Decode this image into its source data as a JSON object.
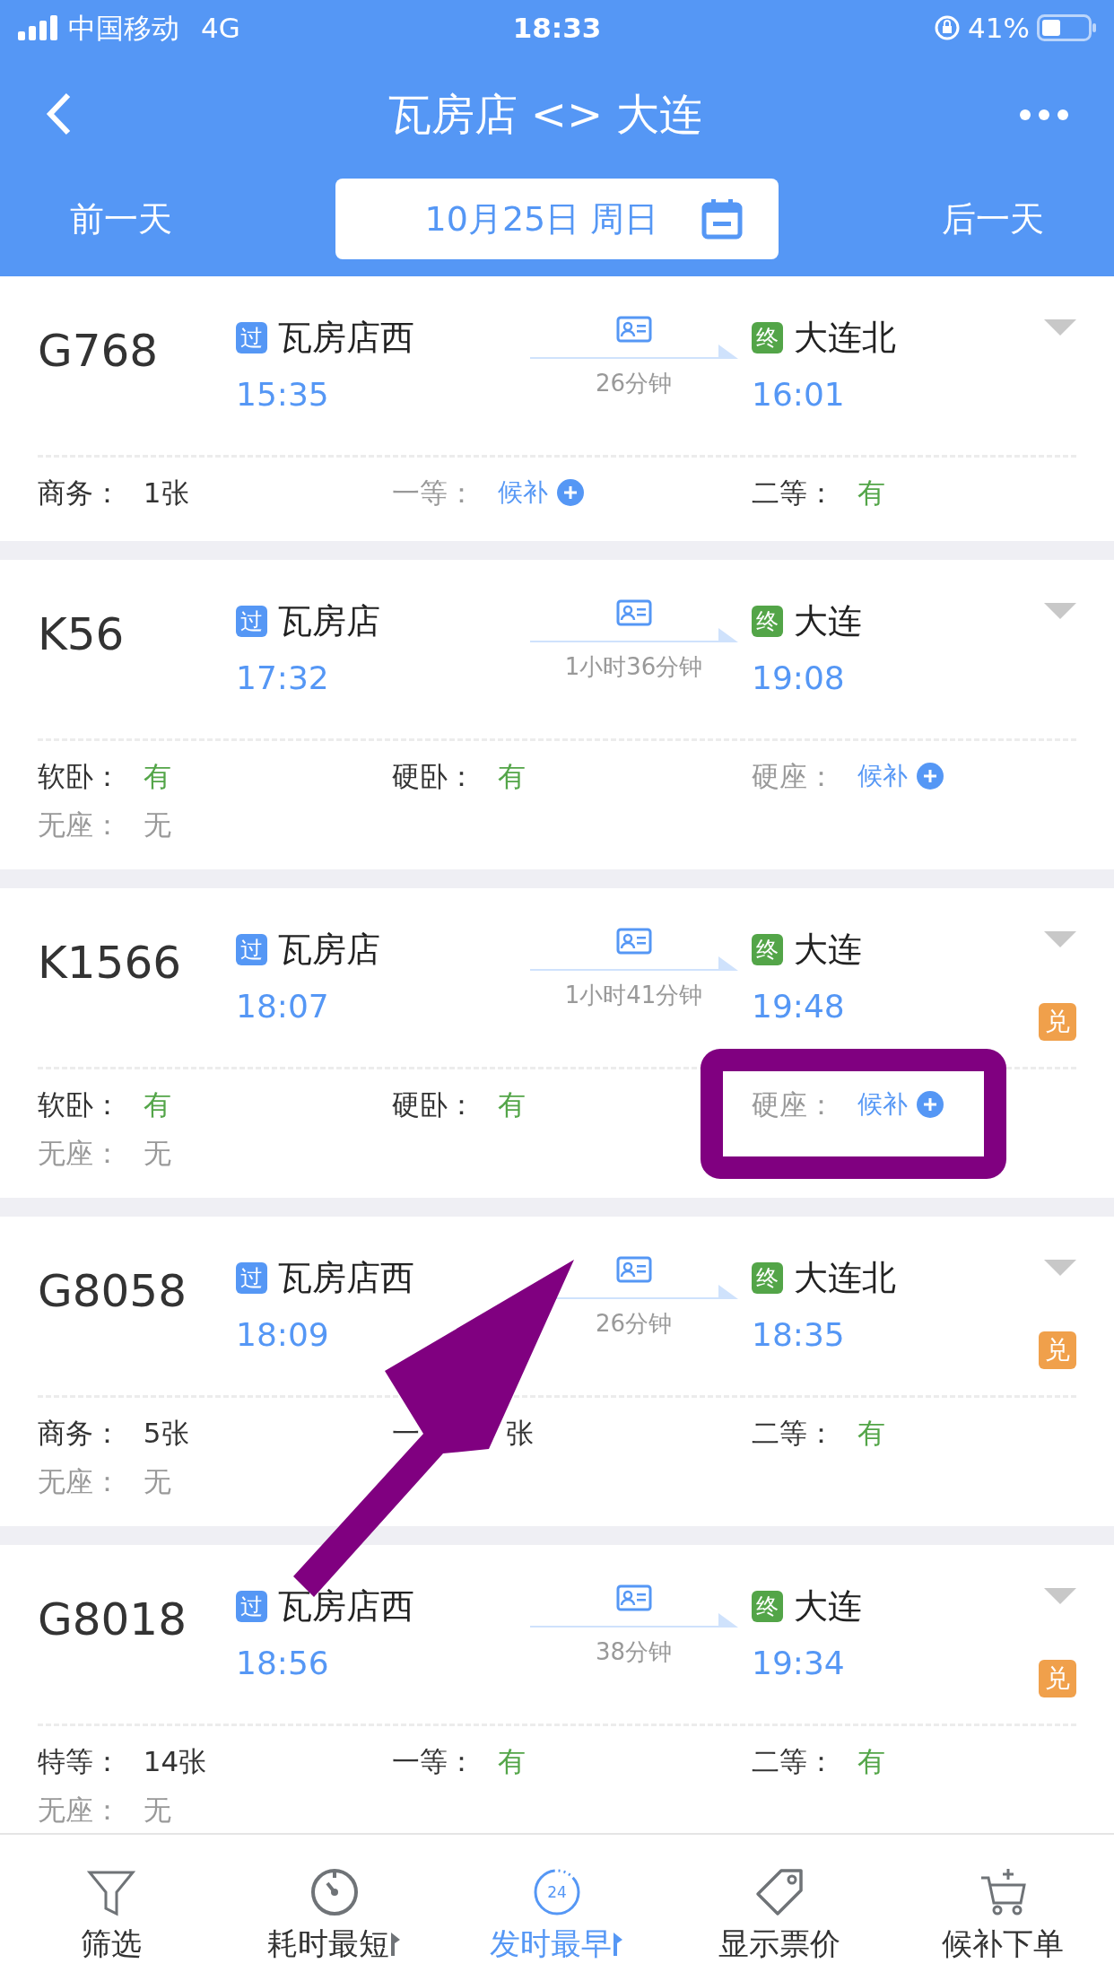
{
  "status_bar": {
    "carrier": "中国移动",
    "network": "4G",
    "time": "18:33",
    "battery": "41%"
  },
  "nav": {
    "title": "瓦房店 <> 大连",
    "prev_day": "前一天",
    "date": "10月25日 周日",
    "next_day": "后一天"
  },
  "trains": [
    {
      "number": "G768",
      "from_tag": "过",
      "from": "瓦房店西",
      "depart": "15:35",
      "duration": "26分钟",
      "to_tag": "终",
      "to": "大连北",
      "arrive": "16:01",
      "seats": [
        {
          "label": "商务：",
          "value": "1张",
          "kind": "count"
        },
        {
          "label": "一等：",
          "value": "候补",
          "kind": "waitlist"
        },
        {
          "label": "二等：",
          "value": "有",
          "kind": "available"
        }
      ]
    },
    {
      "number": "K56",
      "from_tag": "过",
      "from": "瓦房店",
      "depart": "17:32",
      "duration": "1小时36分钟",
      "to_tag": "终",
      "to": "大连",
      "arrive": "19:08",
      "seats": [
        {
          "label": "软卧：",
          "value": "有",
          "kind": "available"
        },
        {
          "label": "硬卧：",
          "value": "有",
          "kind": "available"
        },
        {
          "label": "硬座：",
          "value": "候补",
          "kind": "waitlist"
        },
        {
          "label": "无座：",
          "value": "无",
          "kind": "none"
        }
      ]
    },
    {
      "number": "K1566",
      "from_tag": "过",
      "from": "瓦房店",
      "depart": "18:07",
      "duration": "1小时41分钟",
      "to_tag": "终",
      "to": "大连",
      "arrive": "19:48",
      "badge": "兑",
      "seats": [
        {
          "label": "软卧：",
          "value": "有",
          "kind": "available"
        },
        {
          "label": "硬卧：",
          "value": "有",
          "kind": "available"
        },
        {
          "label": "硬座：",
          "value": "候补",
          "kind": "waitlist"
        },
        {
          "label": "无座：",
          "value": "无",
          "kind": "none"
        }
      ]
    },
    {
      "number": "G8058",
      "from_tag": "过",
      "from": "瓦房店西",
      "depart": "18:09",
      "duration": "26分钟",
      "to_tag": "终",
      "to": "大连北",
      "arrive": "18:35",
      "badge": "兑",
      "seats": [
        {
          "label": "商务：",
          "value": "5张",
          "kind": "count"
        },
        {
          "text": "一 张",
          "kind": "covered"
        },
        {
          "label": "二等：",
          "value": "有",
          "kind": "available"
        },
        {
          "label": "无座：",
          "value": "无",
          "kind": "none"
        }
      ]
    },
    {
      "number": "G8018",
      "from_tag": "过",
      "from": "瓦房店西",
      "depart": "18:56",
      "duration": "38分钟",
      "to_tag": "终",
      "to": "大连",
      "arrive": "19:34",
      "badge": "兑",
      "seats": [
        {
          "label": "特等：",
          "value": "14张",
          "kind": "count"
        },
        {
          "label": "一等：",
          "value": "有",
          "kind": "available"
        },
        {
          "label": "二等：",
          "value": "有",
          "kind": "available"
        },
        {
          "label": "无座：",
          "value": "无",
          "kind": "none"
        }
      ]
    }
  ],
  "tab_bar": [
    {
      "label": "筛选",
      "kind": "filter",
      "selected": false,
      "sortable": false
    },
    {
      "label": "耗时最短",
      "kind": "timer",
      "selected": false,
      "sortable": true
    },
    {
      "label": "发时最早",
      "kind": "clock",
      "icon_text": "24",
      "selected": true,
      "sortable": true
    },
    {
      "label": "显示票价",
      "kind": "tag",
      "selected": false,
      "sortable": false
    },
    {
      "label": "候补下单",
      "kind": "cart",
      "selected": false,
      "sortable": false
    }
  ],
  "annotations": {
    "highlight_frame": true,
    "pointer_arrow": true
  }
}
